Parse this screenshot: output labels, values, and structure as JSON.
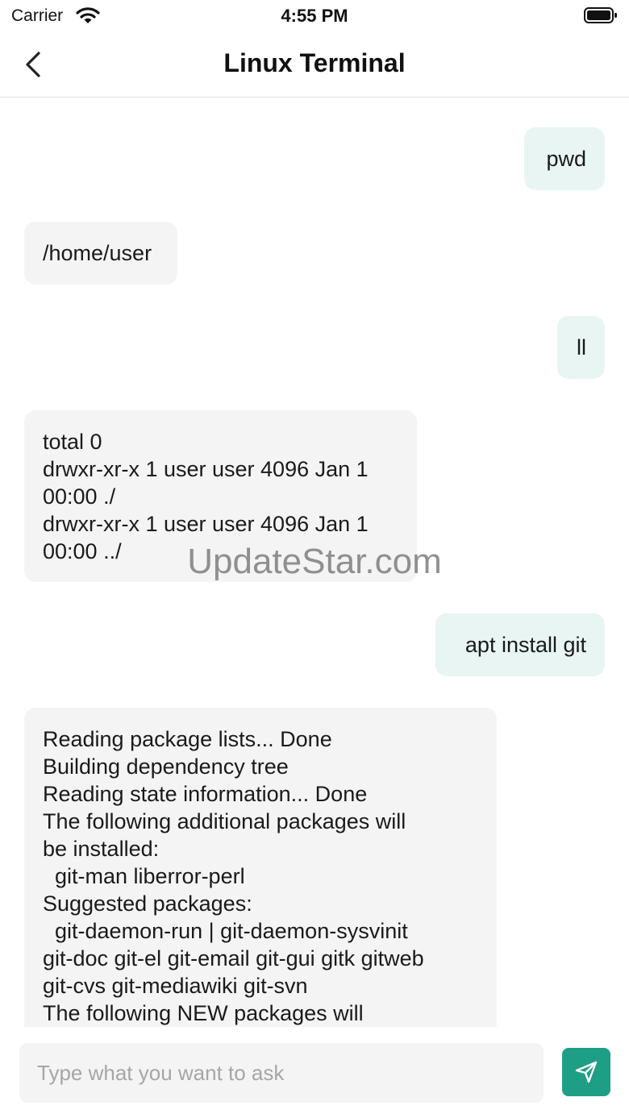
{
  "status_bar": {
    "carrier": "Carrier",
    "time": "4:55 PM",
    "icons": [
      "wifi-icon",
      "battery-icon"
    ]
  },
  "nav": {
    "title": "Linux Terminal",
    "back_icon": "chevron-left-icon"
  },
  "messages": [
    {
      "role": "user",
      "text": "pwd"
    },
    {
      "role": "bot",
      "text": "/home/user"
    },
    {
      "role": "user",
      "text": "ll"
    },
    {
      "role": "bot",
      "text": "total 0\ndrwxr-xr-x 1 user user 4096 Jan 1\n00:00 ./\ndrwxr-xr-x 1 user user 4096 Jan 1\n00:00 ../"
    },
    {
      "role": "user",
      "text": "apt install git"
    },
    {
      "role": "bot",
      "text": "Reading package lists... Done\nBuilding dependency tree\nReading state information... Done\nThe following additional packages will\nbe installed:\n  git-man liberror-perl\nSuggested packages:\n  git-daemon-run | git-daemon-sysvinit\ngit-doc git-el git-email git-gui gitk gitweb\ngit-cvs git-mediawiki git-svn\nThe following NEW packages will"
    }
  ],
  "watermark": "UpdateStar.com",
  "input": {
    "placeholder": "Type what you want to ask",
    "value": ""
  },
  "send_icon": "send-icon",
  "colors": {
    "accent": "#1f9e86",
    "user_bubble": "#e8f5f2",
    "bot_bubble": "#f4f4f4"
  }
}
